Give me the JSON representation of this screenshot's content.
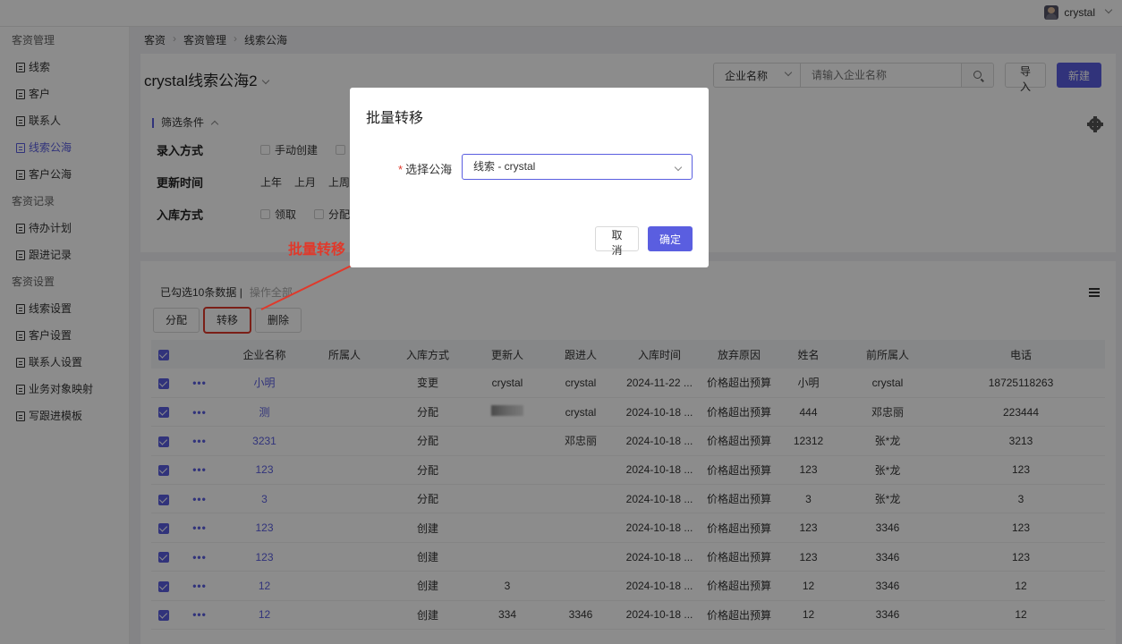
{
  "topbar": {
    "username": "crystal"
  },
  "sidebar": {
    "groups": [
      {
        "title": "客资管理",
        "items": [
          "线索",
          "客户",
          "联系人",
          "线索公海",
          "客户公海"
        ]
      },
      {
        "title": "客资记录",
        "items": [
          "待办计划",
          "跟进记录"
        ]
      },
      {
        "title": "客资设置",
        "items": [
          "线索设置",
          "客户设置",
          "联系人设置",
          "业务对象映射",
          "写跟进模板"
        ]
      }
    ],
    "active": "线索公海"
  },
  "breadcrumb": [
    "客资",
    "客资管理",
    "线索公海"
  ],
  "page": {
    "title": "crystal线索公海2"
  },
  "search": {
    "field": "企业名称",
    "placeholder": "请输入企业名称"
  },
  "toolbar": {
    "import_label": "导入",
    "new_label": "新建"
  },
  "filters": {
    "header": "筛选条件",
    "row1_label": "录入方式",
    "row1_opt1": "手动创建",
    "row2_label": "更新时间",
    "row2_opts": [
      "上年",
      "上月",
      "上周"
    ],
    "row3_label": "入库方式",
    "row3_opt1": "领取",
    "row3_opt2": "分配"
  },
  "selection": {
    "info": "已勾选10条数据",
    "separator": "|",
    "all": "操作全部"
  },
  "actions": {
    "assign": "分配",
    "transfer": "转移",
    "delete": "删除"
  },
  "table": {
    "columns": [
      "企业名称",
      "所属人",
      "入库方式",
      "更新人",
      "跟进人",
      "入库时间",
      "放弃原因",
      "姓名",
      "前所属人",
      "电话"
    ],
    "rows": [
      {
        "company": "小明",
        "owner": "",
        "method": "变更",
        "updater": "crystal",
        "follower": "crystal",
        "time": "2024-11-22 ...",
        "reason": "价格超出预算",
        "name": "小明",
        "prev": "crystal",
        "phone": "18725118263"
      },
      {
        "company": "测",
        "owner": "",
        "method": "分配",
        "updater": "",
        "follower": "crystal",
        "time": "2024-10-18 ...",
        "reason": "价格超出预算",
        "name": "444",
        "prev": "邓忠丽",
        "phone": "223444"
      },
      {
        "company": "3231",
        "owner": "",
        "method": "分配",
        "updater": "",
        "follower": "邓忠丽",
        "time": "2024-10-18 ...",
        "reason": "价格超出预算",
        "name": "12312",
        "prev": "张*龙",
        "phone": "3213"
      },
      {
        "company": "123",
        "owner": "",
        "method": "分配",
        "updater": "",
        "follower": "",
        "time": "2024-10-18 ...",
        "reason": "价格超出预算",
        "name": "123",
        "prev": "张*龙",
        "phone": "123"
      },
      {
        "company": "3",
        "owner": "",
        "method": "分配",
        "updater": "",
        "follower": "",
        "time": "2024-10-18 ...",
        "reason": "价格超出预算",
        "name": "3",
        "prev": "张*龙",
        "phone": "3"
      },
      {
        "company": "123",
        "owner": "",
        "method": "创建",
        "updater": "",
        "follower": "",
        "time": "2024-10-18 ...",
        "reason": "价格超出预算",
        "name": "123",
        "prev": "3346",
        "phone": "123"
      },
      {
        "company": "123",
        "owner": "",
        "method": "创建",
        "updater": "",
        "follower": "",
        "time": "2024-10-18 ...",
        "reason": "价格超出预算",
        "name": "123",
        "prev": "3346",
        "phone": "123"
      },
      {
        "company": "12",
        "owner": "",
        "method": "创建",
        "updater": "3",
        "follower": "",
        "time": "2024-10-18 ...",
        "reason": "价格超出预算",
        "name": "12",
        "prev": "3346",
        "phone": "12"
      },
      {
        "company": "12",
        "owner": "",
        "method": "创建",
        "updater": "334",
        "follower": "3346",
        "time": "2024-10-18 ...",
        "reason": "价格超出预算",
        "name": "12",
        "prev": "3346",
        "phone": "12"
      }
    ]
  },
  "modal": {
    "title": "批量转移",
    "field_label": "选择公海",
    "required_mark": "*",
    "selected": "线索 - crystal",
    "cancel": "取消",
    "ok": "确定"
  },
  "annotation": {
    "text": "批量转移",
    "color": "#e0392b"
  },
  "colors": {
    "accent": "#5a5ee0",
    "annotation": "#e0392b"
  }
}
